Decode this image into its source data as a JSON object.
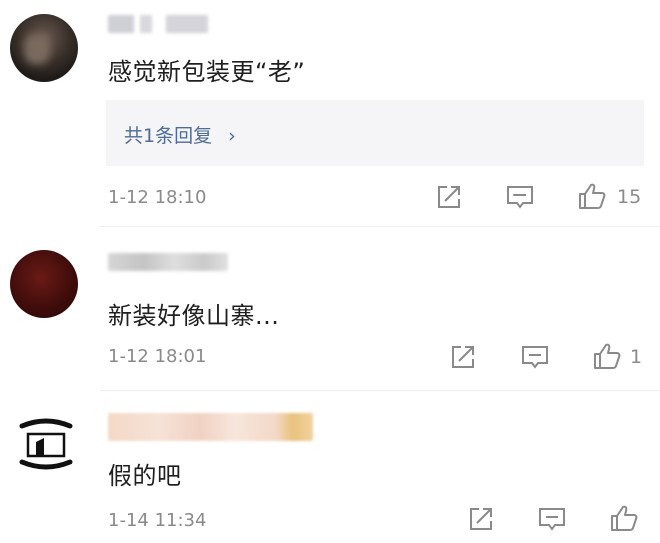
{
  "comments": [
    {
      "text": "感觉新包装更“老”",
      "reply_label": "共1条回复",
      "reply_chevron": "›",
      "time": "1-12 18:10",
      "like_count": "15"
    },
    {
      "text": "新装好像山寨...",
      "time": "1-12 18:01",
      "like_count": "1"
    },
    {
      "text": "假的吧",
      "time": "1-14 11:34",
      "like_count": ""
    }
  ],
  "icons": {
    "share": "share-icon",
    "reply": "comment-icon",
    "like": "thumbs-up-icon"
  },
  "colors": {
    "reply_link": "#4e6a95",
    "meta_gray": "#8a8a8a",
    "reply_box": "#f5f5f7"
  }
}
